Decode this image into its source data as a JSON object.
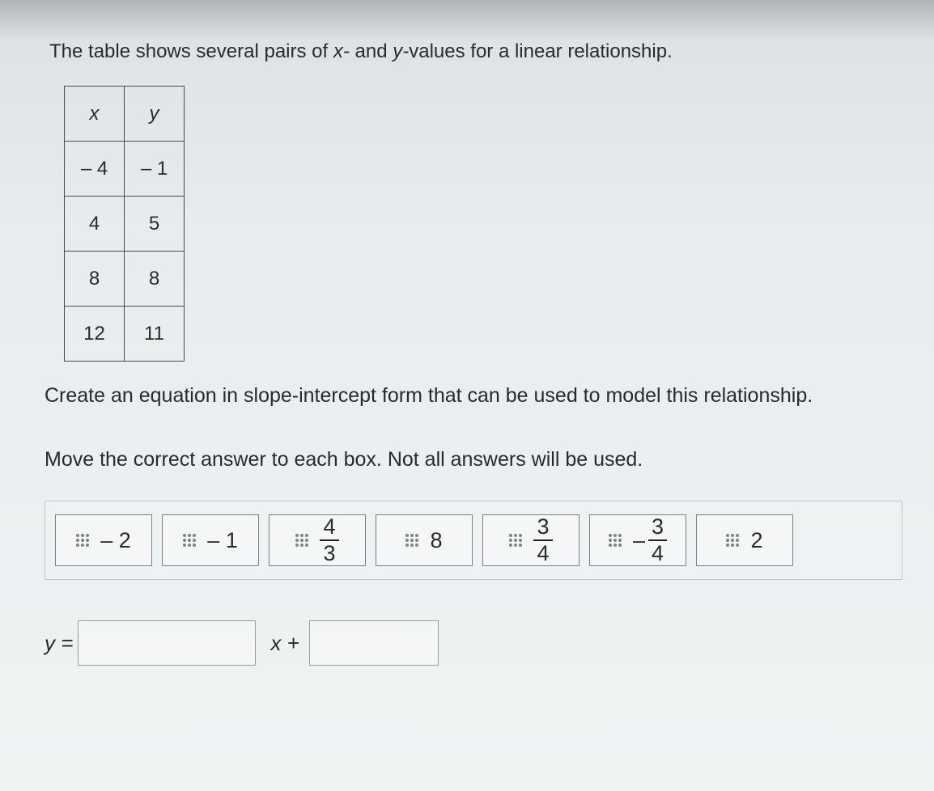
{
  "prompt1_pre": "The table shows several pairs of ",
  "prompt1_xvar": "x-",
  "prompt1_mid": " and ",
  "prompt1_yvar": "y-",
  "prompt1_post": "values for a linear relationship.",
  "table": {
    "head_x": "x",
    "head_y": "y",
    "rows": [
      {
        "x": "– 4",
        "y": "– 1"
      },
      {
        "x": "4",
        "y": "5"
      },
      {
        "x": "8",
        "y": "8"
      },
      {
        "x": "12",
        "y": "11"
      }
    ]
  },
  "prompt2": "Create an equation in slope-intercept form that can be used to model this relationship.",
  "prompt3": "Move the correct answer to each box. Not all answers will be used.",
  "tiles": {
    "t0": "– 2",
    "t1": "– 1",
    "t2_num": "4",
    "t2_den": "3",
    "t3": "8",
    "t4_num": "3",
    "t4_den": "4",
    "t5_neg": "–",
    "t5_num": "3",
    "t5_den": "4",
    "t6": "2"
  },
  "equation": {
    "y_eq": "y =",
    "x_plus": "x +"
  }
}
